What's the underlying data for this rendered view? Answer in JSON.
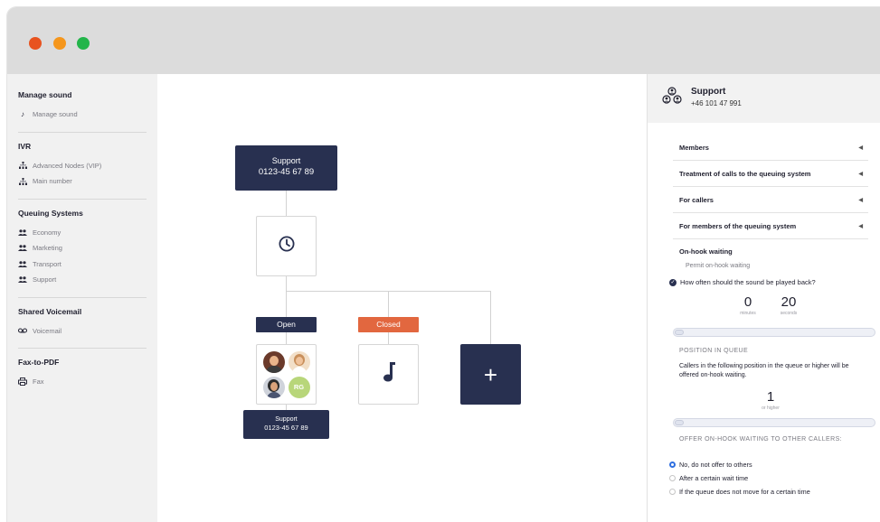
{
  "sidebar": {
    "sections": [
      {
        "title": "Manage sound",
        "items": [
          {
            "label": "Manage sound",
            "icon": "music-note-icon"
          }
        ]
      },
      {
        "title": "IVR",
        "items": [
          {
            "label": "Advanced Nodes (VIP)",
            "icon": "hierarchy-icon"
          },
          {
            "label": "Main number",
            "icon": "hierarchy-icon"
          }
        ]
      },
      {
        "title": "Queuing Systems",
        "items": [
          {
            "label": "Economy",
            "icon": "group-icon"
          },
          {
            "label": "Marketing",
            "icon": "group-icon"
          },
          {
            "label": "Transport",
            "icon": "group-icon"
          },
          {
            "label": "Support",
            "icon": "group-icon"
          }
        ]
      },
      {
        "title": "Shared Voicemail",
        "items": [
          {
            "label": "Voicemail",
            "icon": "voicemail-icon"
          }
        ]
      },
      {
        "title": "Fax-to-PDF",
        "items": [
          {
            "label": "Fax",
            "icon": "printer-icon"
          }
        ]
      }
    ]
  },
  "flow": {
    "root": {
      "title": "Support",
      "number": "0123-45 67 89"
    },
    "open_label": "Open",
    "closed_label": "Closed",
    "avatar_initials": "RG",
    "queue": {
      "title": "Support",
      "number": "0123-45 67 89"
    },
    "add_label": "+"
  },
  "panel": {
    "title": "Support",
    "phone": "+46 101 47 991",
    "accordions": [
      "Members",
      "Treatment of calls to the queuing system",
      "For callers",
      "For members of the queuing system"
    ],
    "onhook_title": "On-hook waiting",
    "onhook_permit": "Permit on-hook waiting",
    "sound_question": "How often should the sound be played back?",
    "minutes_value": "0",
    "minutes_label": "minutes",
    "seconds_value": "20",
    "seconds_label": "seconds",
    "position_title": "POSITION IN QUEUE",
    "position_desc": "Callers in the following position in the queue or higher will be offered on-hook waiting.",
    "position_value": "1",
    "position_label": "or higher",
    "offer_title": "OFFER ON-HOOK WAITING TO OTHER CALLERS:",
    "options": [
      {
        "label": "No, do not offer to others",
        "selected": true
      },
      {
        "label": "After a certain wait time",
        "selected": false
      },
      {
        "label": "If the queue does not move for a certain time",
        "selected": false
      }
    ]
  },
  "colors": {
    "dark_node": "#283050",
    "open_tag": "#283050",
    "closed_tag": "#e2673f",
    "radio_selected": "#2f6fe0"
  }
}
